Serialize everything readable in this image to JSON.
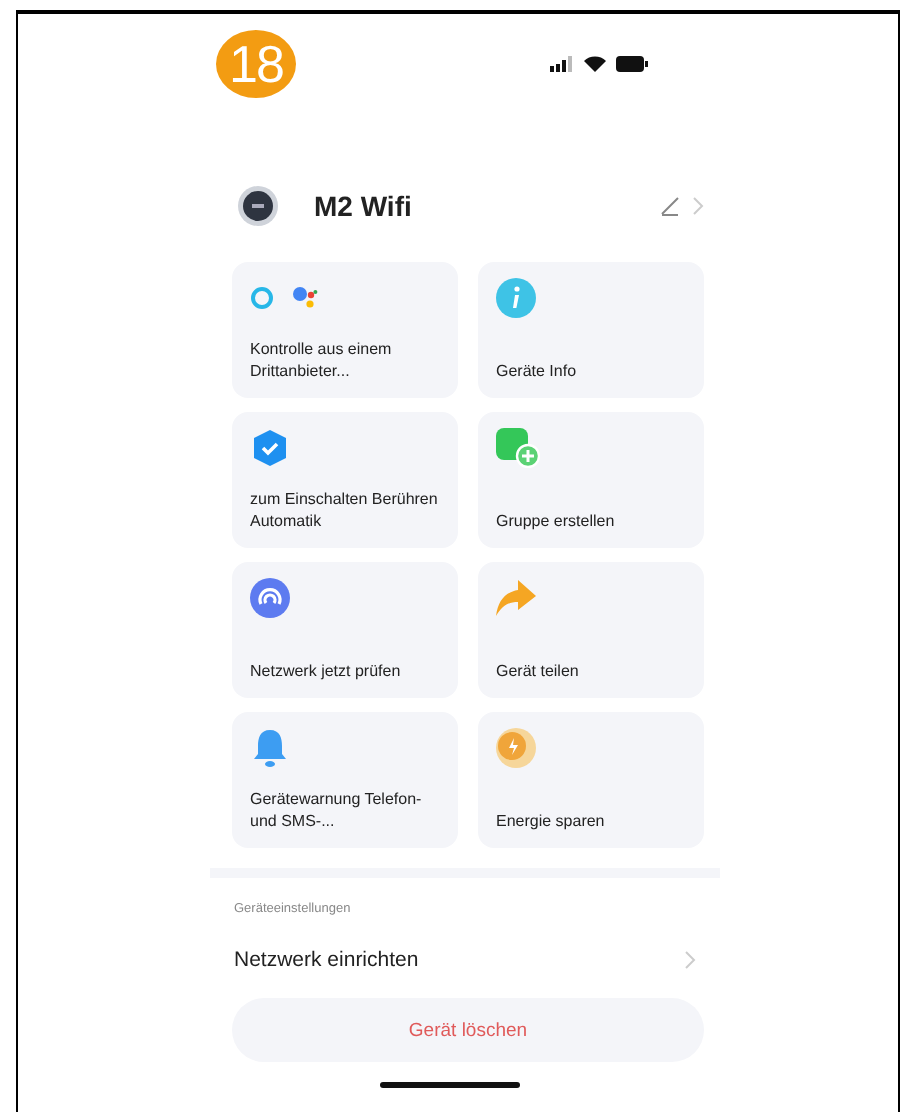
{
  "step_badge": "18",
  "device": {
    "name": "M2 Wifi"
  },
  "tiles": [
    {
      "label": "Kontrolle aus einem Drittanbieter..."
    },
    {
      "label": "Geräte Info"
    },
    {
      "label": "zum Einschalten Berühren Automatik"
    },
    {
      "label": "Gruppe erstellen"
    },
    {
      "label": "Netzwerk jetzt prüfen"
    },
    {
      "label": "Gerät teilen"
    },
    {
      "label": "Gerätewarnung Telefon- und SMS-..."
    },
    {
      "label": "Energie sparen"
    }
  ],
  "section_title": "Geräteeinstellungen",
  "settings": [
    {
      "label": "Netzwerk einrichten"
    }
  ],
  "delete_button": "Gerät löschen"
}
